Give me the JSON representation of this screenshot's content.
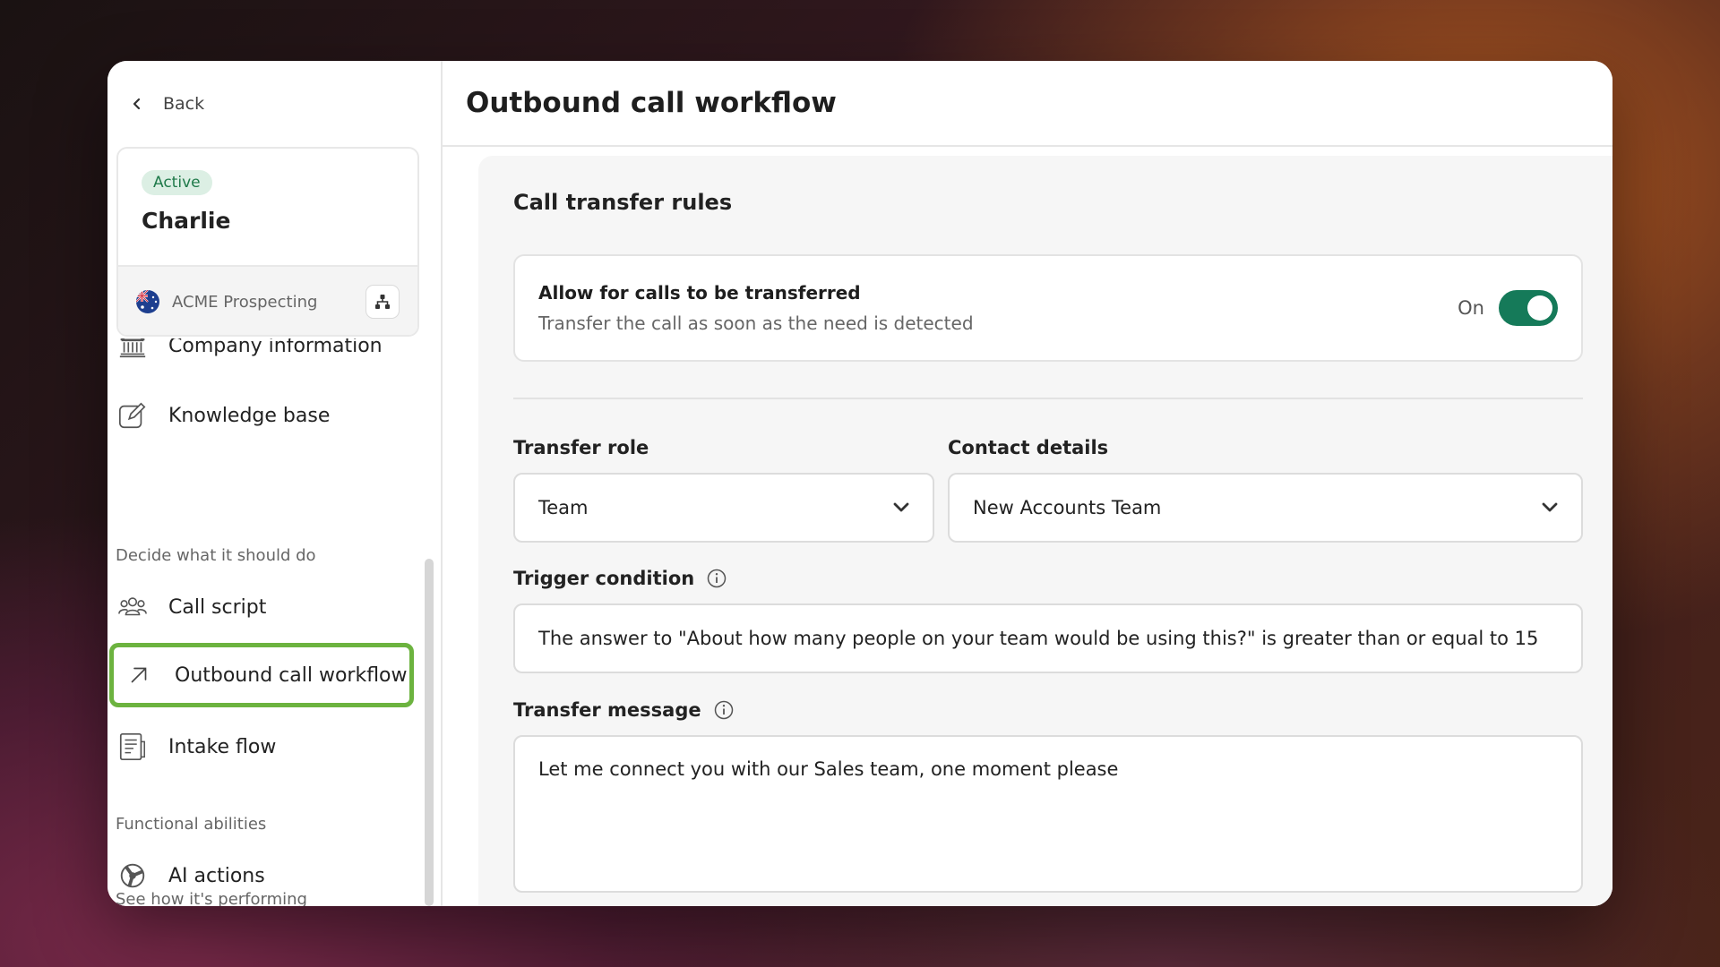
{
  "sidebar": {
    "back_label": "Back",
    "agent": {
      "status": "Active",
      "name": "Charlie",
      "org": "ACME Prospecting"
    },
    "items": [
      {
        "label": "Company information",
        "icon": "bank-icon"
      },
      {
        "label": "Knowledge base",
        "icon": "edit-icon"
      },
      {
        "label": "Call script",
        "icon": "people-icon"
      },
      {
        "label": "Outbound call workflow",
        "icon": "arrow-up-right-icon"
      },
      {
        "label": "Intake flow",
        "icon": "form-icon"
      },
      {
        "label": "AI actions",
        "icon": "ai-icon"
      }
    ],
    "sections": [
      "Decide what it should do",
      "Functional abilities",
      "See how it's performing"
    ]
  },
  "main": {
    "title": "Outbound call workflow",
    "section_title": "Call transfer rules",
    "transfer_toggle": {
      "title": "Allow for calls to be transferred",
      "description": "Transfer the call as soon as the need is detected",
      "state_label": "On",
      "enabled": true
    },
    "transfer_role": {
      "label": "Transfer role",
      "value": "Team"
    },
    "contact_details": {
      "label": "Contact details",
      "value": "New Accounts Team"
    },
    "trigger_condition": {
      "label": "Trigger condition",
      "value": "The answer to \"About how many people on your team would be using this?\" is greater than or equal to 15"
    },
    "transfer_message": {
      "label": "Transfer message",
      "value": "Let me connect you with our Sales team, one moment please"
    }
  },
  "colors": {
    "accent_green": "#157a59",
    "active_outline": "#6cb33f",
    "badge_bg": "#dcefe4",
    "badge_text": "#1f7a4a"
  }
}
